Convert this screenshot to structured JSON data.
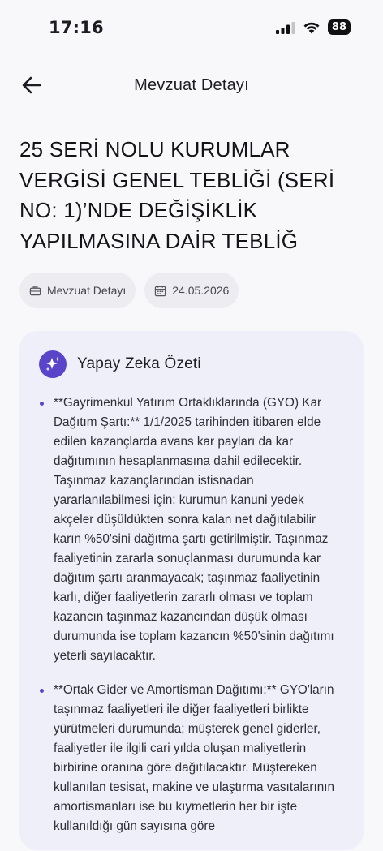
{
  "status_bar": {
    "time": "17:16",
    "battery": "88"
  },
  "nav": {
    "title": "Mevzuat Detayı"
  },
  "document": {
    "title": "25 SERİ NOLU KURUMLAR VERGİSİ GENEL TEBLİĞİ (SERİ NO: 1)’NDE DEĞİŞİKLİK YAPILMASINA DAİR TEBLİĞ",
    "category_chip": "Mevzuat Detayı",
    "date_chip": "24.05.2026"
  },
  "summary": {
    "title": "Yapay Zeka Özeti",
    "items": [
      {
        "text": "**Gayrimenkul Yatırım Ortaklıklarında (GYO) Kar Dağıtım Şartı:** 1/1/2025 tarihinden itibaren elde edilen kazançlarda avans kar payları da kar dağıtımının hesaplanmasına dahil edilecektir. Taşınmaz kazançlarından istisnadan yararlanılabilmesi için; kurumun kanuni yedek akçeler düşüldükten sonra kalan net dağıtılabilir karın %50'sini dağıtma şartı getirilmiştir. Taşınmaz faaliyetinin zararla sonuçlanması durumunda kar dağıtım şartı aranmayacak; taşınmaz faaliyetinin karlı, diğer faaliyetlerin zararlı olması ve toplam kazancın taşınmaz kazancından düşük olması durumunda ise toplam kazancın %50'sinin dağıtımı yeterli sayılacaktır."
      },
      {
        "text": "**Ortak Gider ve Amortisman Dağıtımı:** GYO'ların taşınmaz faaliyetleri ile diğer faaliyetleri birlikte yürütmeleri durumunda; müşterek genel giderler, faaliyetler ile ilgili cari yılda oluşan maliyetlerin birbirine oranına göre dağıtılacaktır. Müştereken kullanılan tesisat, makine ve ulaştırma vasıtalarının amortismanları ise bu kıymetlerin her bir işte kullanıldığı gün sayısına göre"
      }
    ]
  },
  "colors": {
    "background": "#f8f8fb",
    "card": "#efeff9",
    "accent": "#5a44c9",
    "chip": "#ececf1"
  },
  "icons": {
    "back": "arrow-left-icon",
    "category": "briefcase-icon",
    "date": "calendar-icon",
    "ai": "sparkles-icon",
    "signal": "cellular-signal-icon",
    "wifi": "wifi-icon",
    "battery": "battery-icon"
  }
}
